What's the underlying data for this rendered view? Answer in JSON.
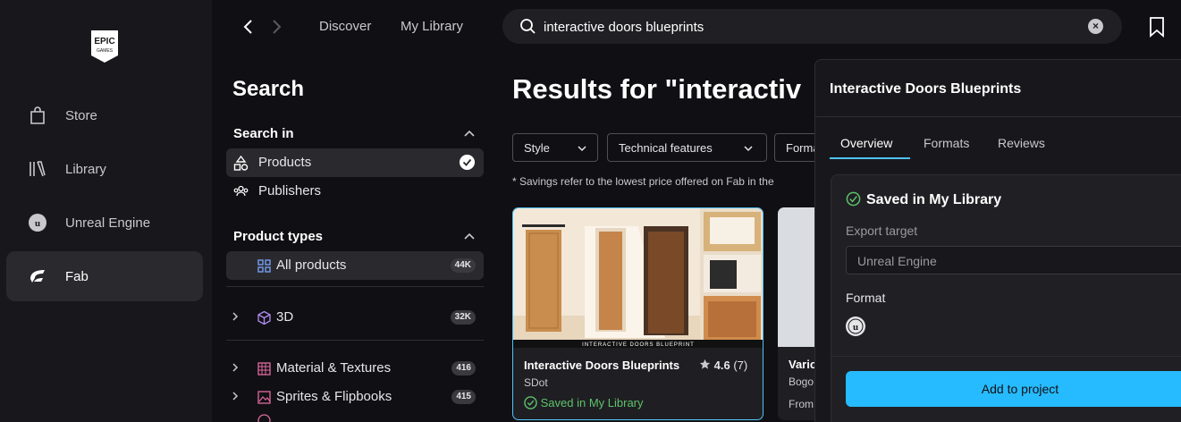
{
  "app_nav": {
    "logo_text_top": "EPIC",
    "logo_text_bottom": "GAMES",
    "items": [
      {
        "label": "Store",
        "icon": "shopping-bag-icon"
      },
      {
        "label": "Library",
        "icon": "library-icon"
      },
      {
        "label": "Unreal Engine",
        "icon": "unreal-engine-icon"
      },
      {
        "label": "Fab",
        "icon": "fab-icon",
        "active": true
      }
    ]
  },
  "topbar": {
    "links": [
      "Discover",
      "My Library"
    ],
    "search_value": "interactive doors blueprints",
    "clear_label": "×"
  },
  "filters": {
    "title": "Search",
    "search_in": {
      "title": "Search in",
      "items": [
        {
          "label": "Products",
          "selected": true
        },
        {
          "label": "Publishers"
        }
      ]
    },
    "product_types": {
      "title": "Product types",
      "items": [
        {
          "label": "All products",
          "count": "44K",
          "selected": true
        },
        {
          "label": "3D",
          "count": "32K"
        },
        {
          "label": "Material & Textures",
          "count": "416"
        },
        {
          "label": "Sprites & Flipbooks",
          "count": "415"
        }
      ]
    }
  },
  "results": {
    "heading": "Results for \"interactiv",
    "dropdowns": [
      "Style",
      "Technical features",
      "Forma"
    ],
    "note": "* Savings refer to the lowest price offered on Fab in the",
    "cards": [
      {
        "title": "Interactive Doors Blueprints",
        "rating": "4.6",
        "reviews": "(7)",
        "seller": "SDot",
        "status": "Saved in My Library",
        "banner": "INTERACTIVE DOORS BLUEPRINT"
      },
      {
        "title": "Vario",
        "seller": "Bogo",
        "price_prefix": "From"
      }
    ]
  },
  "panel": {
    "title": "Interactive Doors Blueprints",
    "tabs": [
      "Overview",
      "Formats",
      "Reviews"
    ],
    "saved_header": "Saved in My Library",
    "export_label": "Export target",
    "export_value": "Unreal Engine",
    "format_label": "Format",
    "add_button": "Add to project"
  },
  "colors": {
    "accent": "#26bbff",
    "card_border": "#4fc3f7",
    "saved_green": "#5dc26a",
    "background": "#101014",
    "sidebar": "#18181c"
  }
}
